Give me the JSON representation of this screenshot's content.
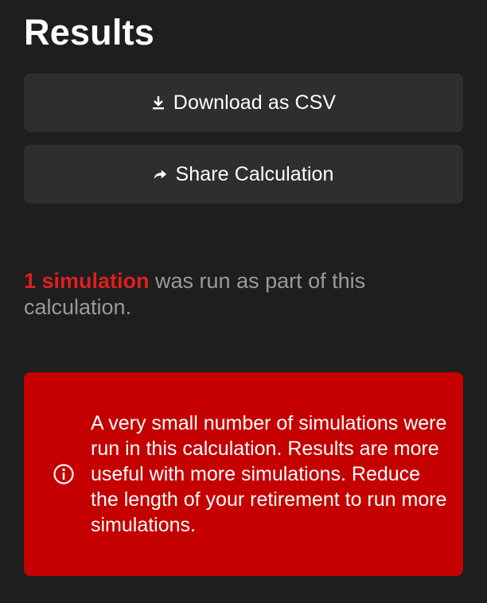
{
  "results": {
    "title": "Results",
    "download_button": {
      "label": "Download as CSV",
      "icon": "download-icon"
    },
    "share_button": {
      "label": "Share Calculation",
      "icon": "share-arrow-icon"
    },
    "summary": {
      "count_text": "1 simulation",
      "rest_text": " was run as part of this calculation."
    },
    "warning": {
      "icon": "info-icon",
      "message": "A very small number of simulations were run in this calculation. Results are more useful with more simulations. Reduce the length of your retirement to run more simulations."
    }
  },
  "colors": {
    "background": "#1e1e1e",
    "button_bg": "#2e2e2e",
    "accent_red": "#e01e1e",
    "alert_bg": "#c40000",
    "muted_text": "#9a9a9a"
  }
}
